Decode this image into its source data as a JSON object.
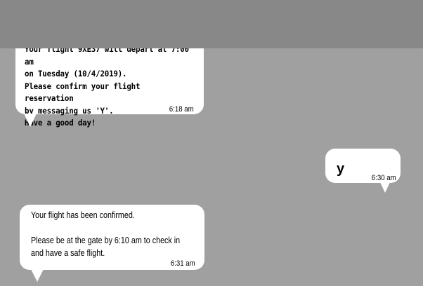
{
  "messages": [
    {
      "sender": "business",
      "text": "Your flight 9XE37 will depart at 7:00 am\non Tuesday (10/4/2019).\nPlease confirm your flight reservation\nby messaging us 'Y'.\nHave a good day!",
      "time": "6:18 am"
    },
    {
      "sender": "user",
      "text": "y",
      "time": "6:30 am"
    },
    {
      "sender": "business",
      "text": "Your flight has been confirmed.\n\nPlease be at the gate by 6:10 am to check in\nand have a safe flight.",
      "time": "6:31 am"
    }
  ],
  "colors": {
    "background": "#a0a0a0",
    "header": "#888888",
    "bubble": "#ffffff"
  }
}
